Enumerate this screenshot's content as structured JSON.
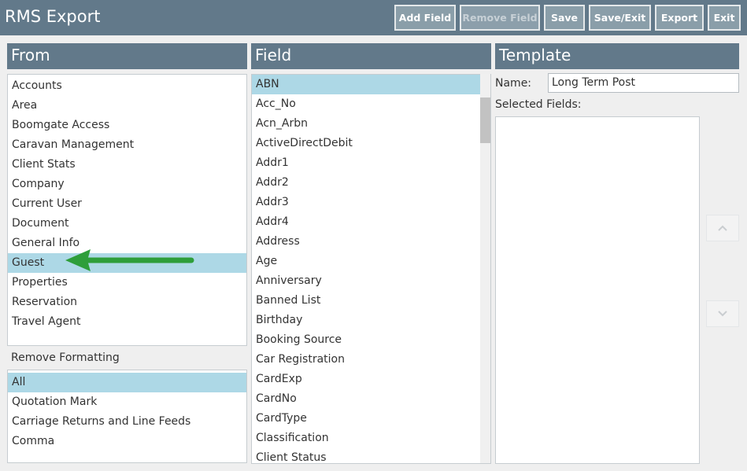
{
  "app": {
    "title": "RMS Export"
  },
  "toolbar": {
    "add_field": "Add Field",
    "remove_field": "Remove Field",
    "save": "Save",
    "save_exit": "Save/Exit",
    "export": "Export",
    "exit": "Exit"
  },
  "from": {
    "header": "From",
    "items": [
      "Accounts",
      "Area",
      "Boomgate Access",
      "Caravan Management",
      "Client Stats",
      "Company",
      "Current User",
      "Document",
      "General Info",
      "Guest",
      "Properties",
      "Reservation",
      "Travel Agent"
    ],
    "selected": "Guest"
  },
  "remove_formatting": {
    "label": "Remove Formatting",
    "items": [
      "All",
      "Quotation Mark",
      "Carriage Returns and Line Feeds",
      "Comma"
    ],
    "selected": "All"
  },
  "field": {
    "header": "Field",
    "items": [
      "ABN",
      "Acc_No",
      "Acn_Arbn",
      "ActiveDirectDebit",
      "Addr1",
      "Addr2",
      "Addr3",
      "Addr4",
      "Address",
      "Age",
      "Anniversary",
      "Banned List",
      "Birthday",
      "Booking Source",
      "Car Registration",
      "CardExp",
      "CardNo",
      "CardType",
      "Classification",
      "Client Status"
    ],
    "selected": "ABN"
  },
  "template": {
    "header": "Template",
    "name_label": "Name:",
    "name_value": "Long Term Post",
    "selected_fields_label": "Selected Fields:"
  },
  "icons": {
    "arrow_annotation": "green-arrow-icon",
    "move_up": "chevron-up-icon",
    "move_down": "chevron-down-icon"
  },
  "colors": {
    "header_bg": "#62798a",
    "selection": "#add8e6",
    "annotation_arrow": "#2e9e3a"
  }
}
